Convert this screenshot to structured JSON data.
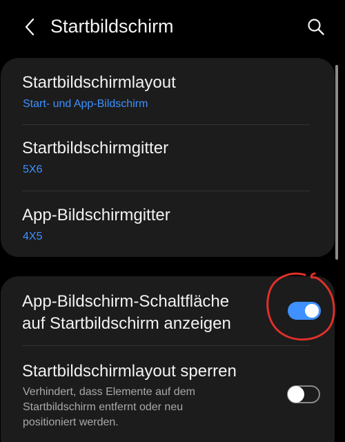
{
  "header": {
    "title": "Startbildschirm",
    "back_icon": "chevron-left-icon",
    "search_icon": "search-icon"
  },
  "card1": {
    "items": [
      {
        "title": "Startbildschirmlayout",
        "value": "Start- und App-Bildschirm"
      },
      {
        "title": "Startbildschirmgitter",
        "value": "5X6"
      },
      {
        "title": "App-Bildschirmgitter",
        "value": "4X5"
      }
    ]
  },
  "card2": {
    "apps_button": {
      "title_line1": "App-Bildschirm-Schaltfläche",
      "title_line2": "auf Startbildschirm anzeigen",
      "enabled": true
    },
    "lock_layout": {
      "title": "Startbildschirmlayout sperren",
      "desc_line1": "Verhindert, dass Elemente auf dem",
      "desc_line2": "Startbildschirm entfernt oder neu",
      "desc_line3": "positioniert werden.",
      "enabled": false
    }
  },
  "colors": {
    "background": "#000000",
    "card": "#1c1c1c",
    "accent": "#3e91ff",
    "annotation": "#e0302a"
  }
}
